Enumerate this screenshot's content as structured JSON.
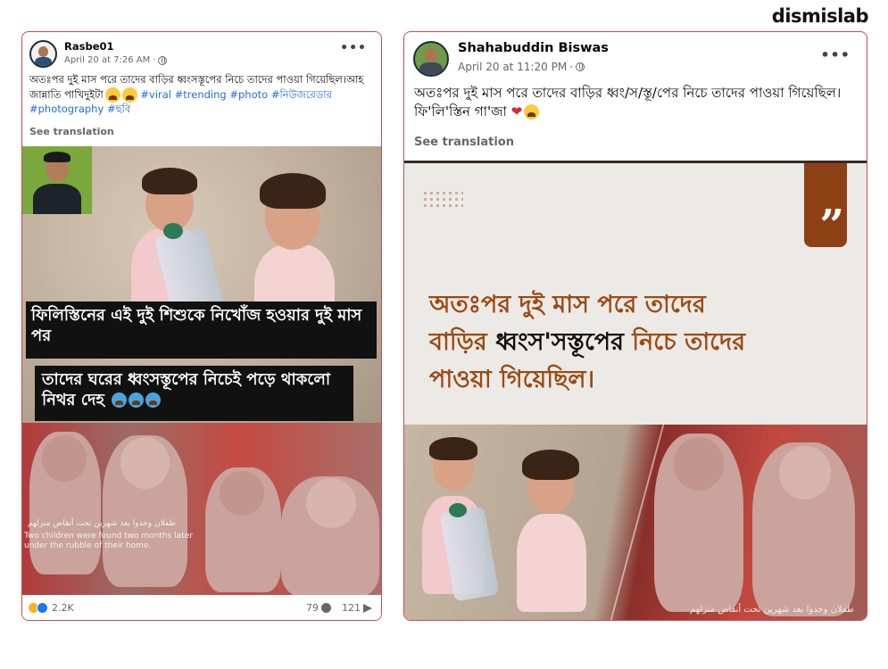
{
  "brand": "dismislab",
  "posts": [
    {
      "author": "Rasbe01",
      "date": "April 20 at 7:26 AM",
      "privacy_dot": "·",
      "text": "অতঃপর  দুই মাস পরে তাদের বাড়ির ধ্বংসস্তূপের নিচে তাদের পাওয়া গিয়েছিল।আহ জান্নাতি পাখিদুইটা",
      "hashtags": [
        "#viral",
        "#trending",
        "#photo",
        "#নিউজরেডার",
        "#photography",
        "#ছবি"
      ],
      "see_translation": "See translation",
      "image": {
        "caption_line1": "ফিলিস্তিনের এই দুই শিশুকে নিখোঁজ হওয়ার দুই মাস পর",
        "caption_line2": "তাদের ঘরের ধ্বংসস্তূপের নিচেই পড়ে থাকলো নিথর দেহ",
        "overlay_arabic": "طفلان وجدوا بعد شهرين تحت أنقاض منزلهم",
        "overlay_english": "Two children were found two months later under the rubble of their home."
      },
      "reactions_count": "2.2K",
      "comments_count": "79",
      "shares_count": "121"
    },
    {
      "author": "Shahabuddin Biswas",
      "date": "April 20 at 11:20 PM",
      "privacy_dot": "·",
      "text": "অতঃপর  দুই মাস পরে তাদের বাড়ির ধ্বং/স/স্তূ/পের নিচে তাদের পাওয়া গিয়েছিল। ফি'লি'স্তিন গা'জা",
      "see_translation": "See translation",
      "image": {
        "quote_line1": "অতঃপর  দুই মাস পরে তাদের",
        "quote_line2_a": "বাড়ির",
        "quote_line2_b": "ধ্বংস'সস্তূপের",
        "quote_line2_c": "নিচে তাদের",
        "quote_line3": "পাওয়া গিয়েছিল।",
        "overlay_arabic": "طفلان وجدوا بعد شهرين تحت أنقاض منزلهم"
      }
    }
  ],
  "colors": {
    "card_border": "#c94a55",
    "hashtag": "#216fdb",
    "quote_orange": "#9c4a12",
    "quote_badge": "#8e4015"
  }
}
